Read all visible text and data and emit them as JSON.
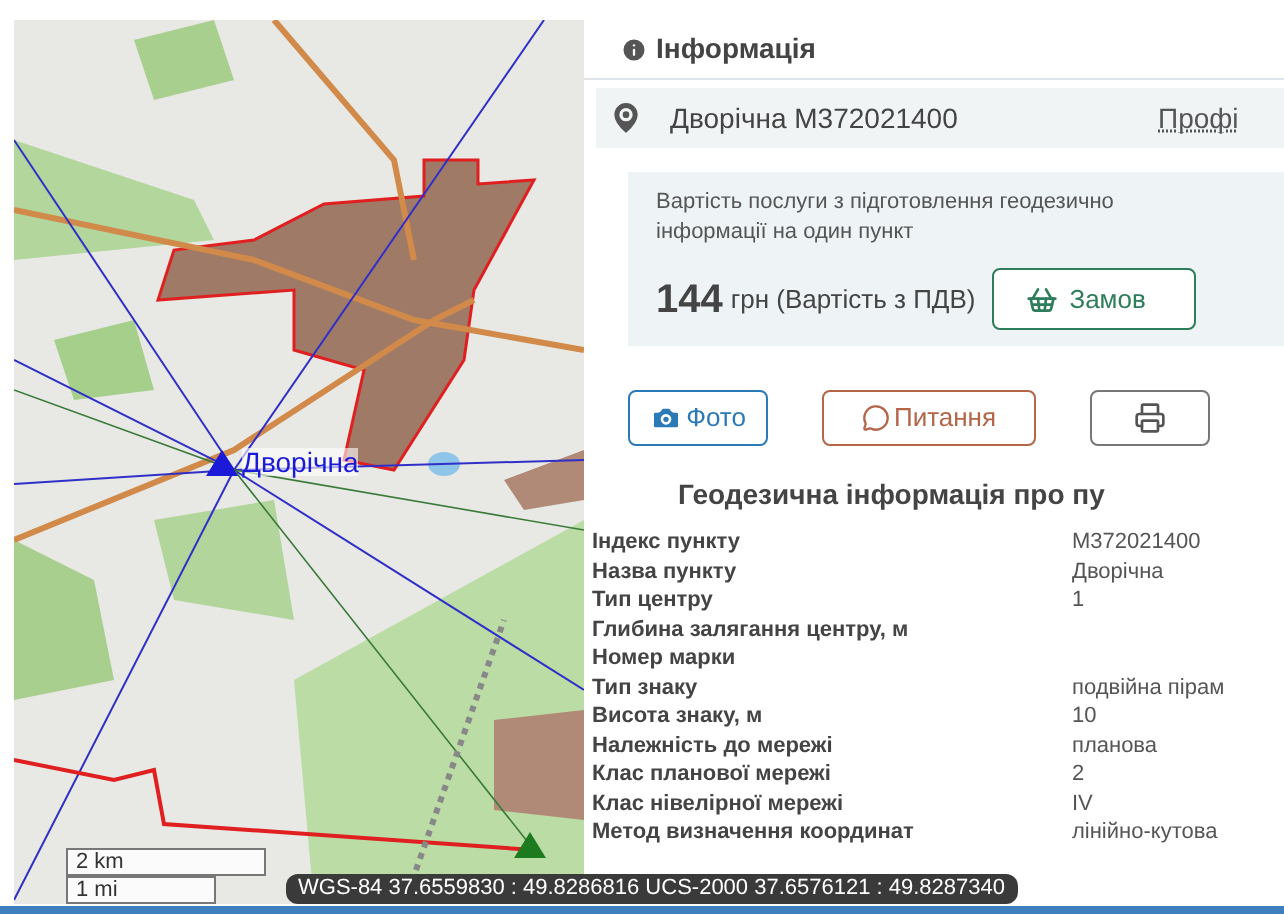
{
  "map": {
    "markers": [
      {
        "label": "Дворічна",
        "color": "#1a1ad8"
      },
      {
        "color": "#1e7a1e"
      }
    ],
    "scale": [
      "2 km",
      "1 mi"
    ],
    "coordinates": "WGS-84 37.6559830 : 49.8286816 UCS-2000 37.6576121 : 49.8287340"
  },
  "panel": {
    "title": "Інформація",
    "point": "Дворічна M372021400",
    "profile_link": "Профі",
    "price": {
      "note": "Вартість послуги з підготовлення геодезично інформації на один пункт",
      "amount": "144",
      "unit": "грн (Вартість з ПДВ)",
      "order_button": "Замов"
    },
    "buttons": [
      {
        "label": "Фото"
      },
      {
        "kind": "question",
        "label": "Питання"
      },
      {
        "kind": "print"
      }
    ],
    "section_title": "Геодезична інформація про пу",
    "rows": [
      {
        "label": "Індекс пункту",
        "value": "M372021400"
      },
      {
        "label": "Назва пункту",
        "value": "Дворічна"
      },
      {
        "label": "Тип центру",
        "value": "1"
      },
      {
        "label": "Глибина залягання центру, м",
        "value": ""
      },
      {
        "label": "Номер марки",
        "value": ""
      },
      {
        "label": "Тип знаку",
        "value": "подвійна пірам"
      },
      {
        "label": "Висота знаку, м",
        "value": "10"
      },
      {
        "label": "Належність до мережі",
        "value": "планова"
      },
      {
        "label": "Клас планової мережі",
        "value": "2"
      },
      {
        "label": "Клас нівелірної мережі",
        "value": "IV"
      },
      {
        "label": "Метод визначення координат",
        "value": "лінійно-кутова"
      }
    ]
  }
}
